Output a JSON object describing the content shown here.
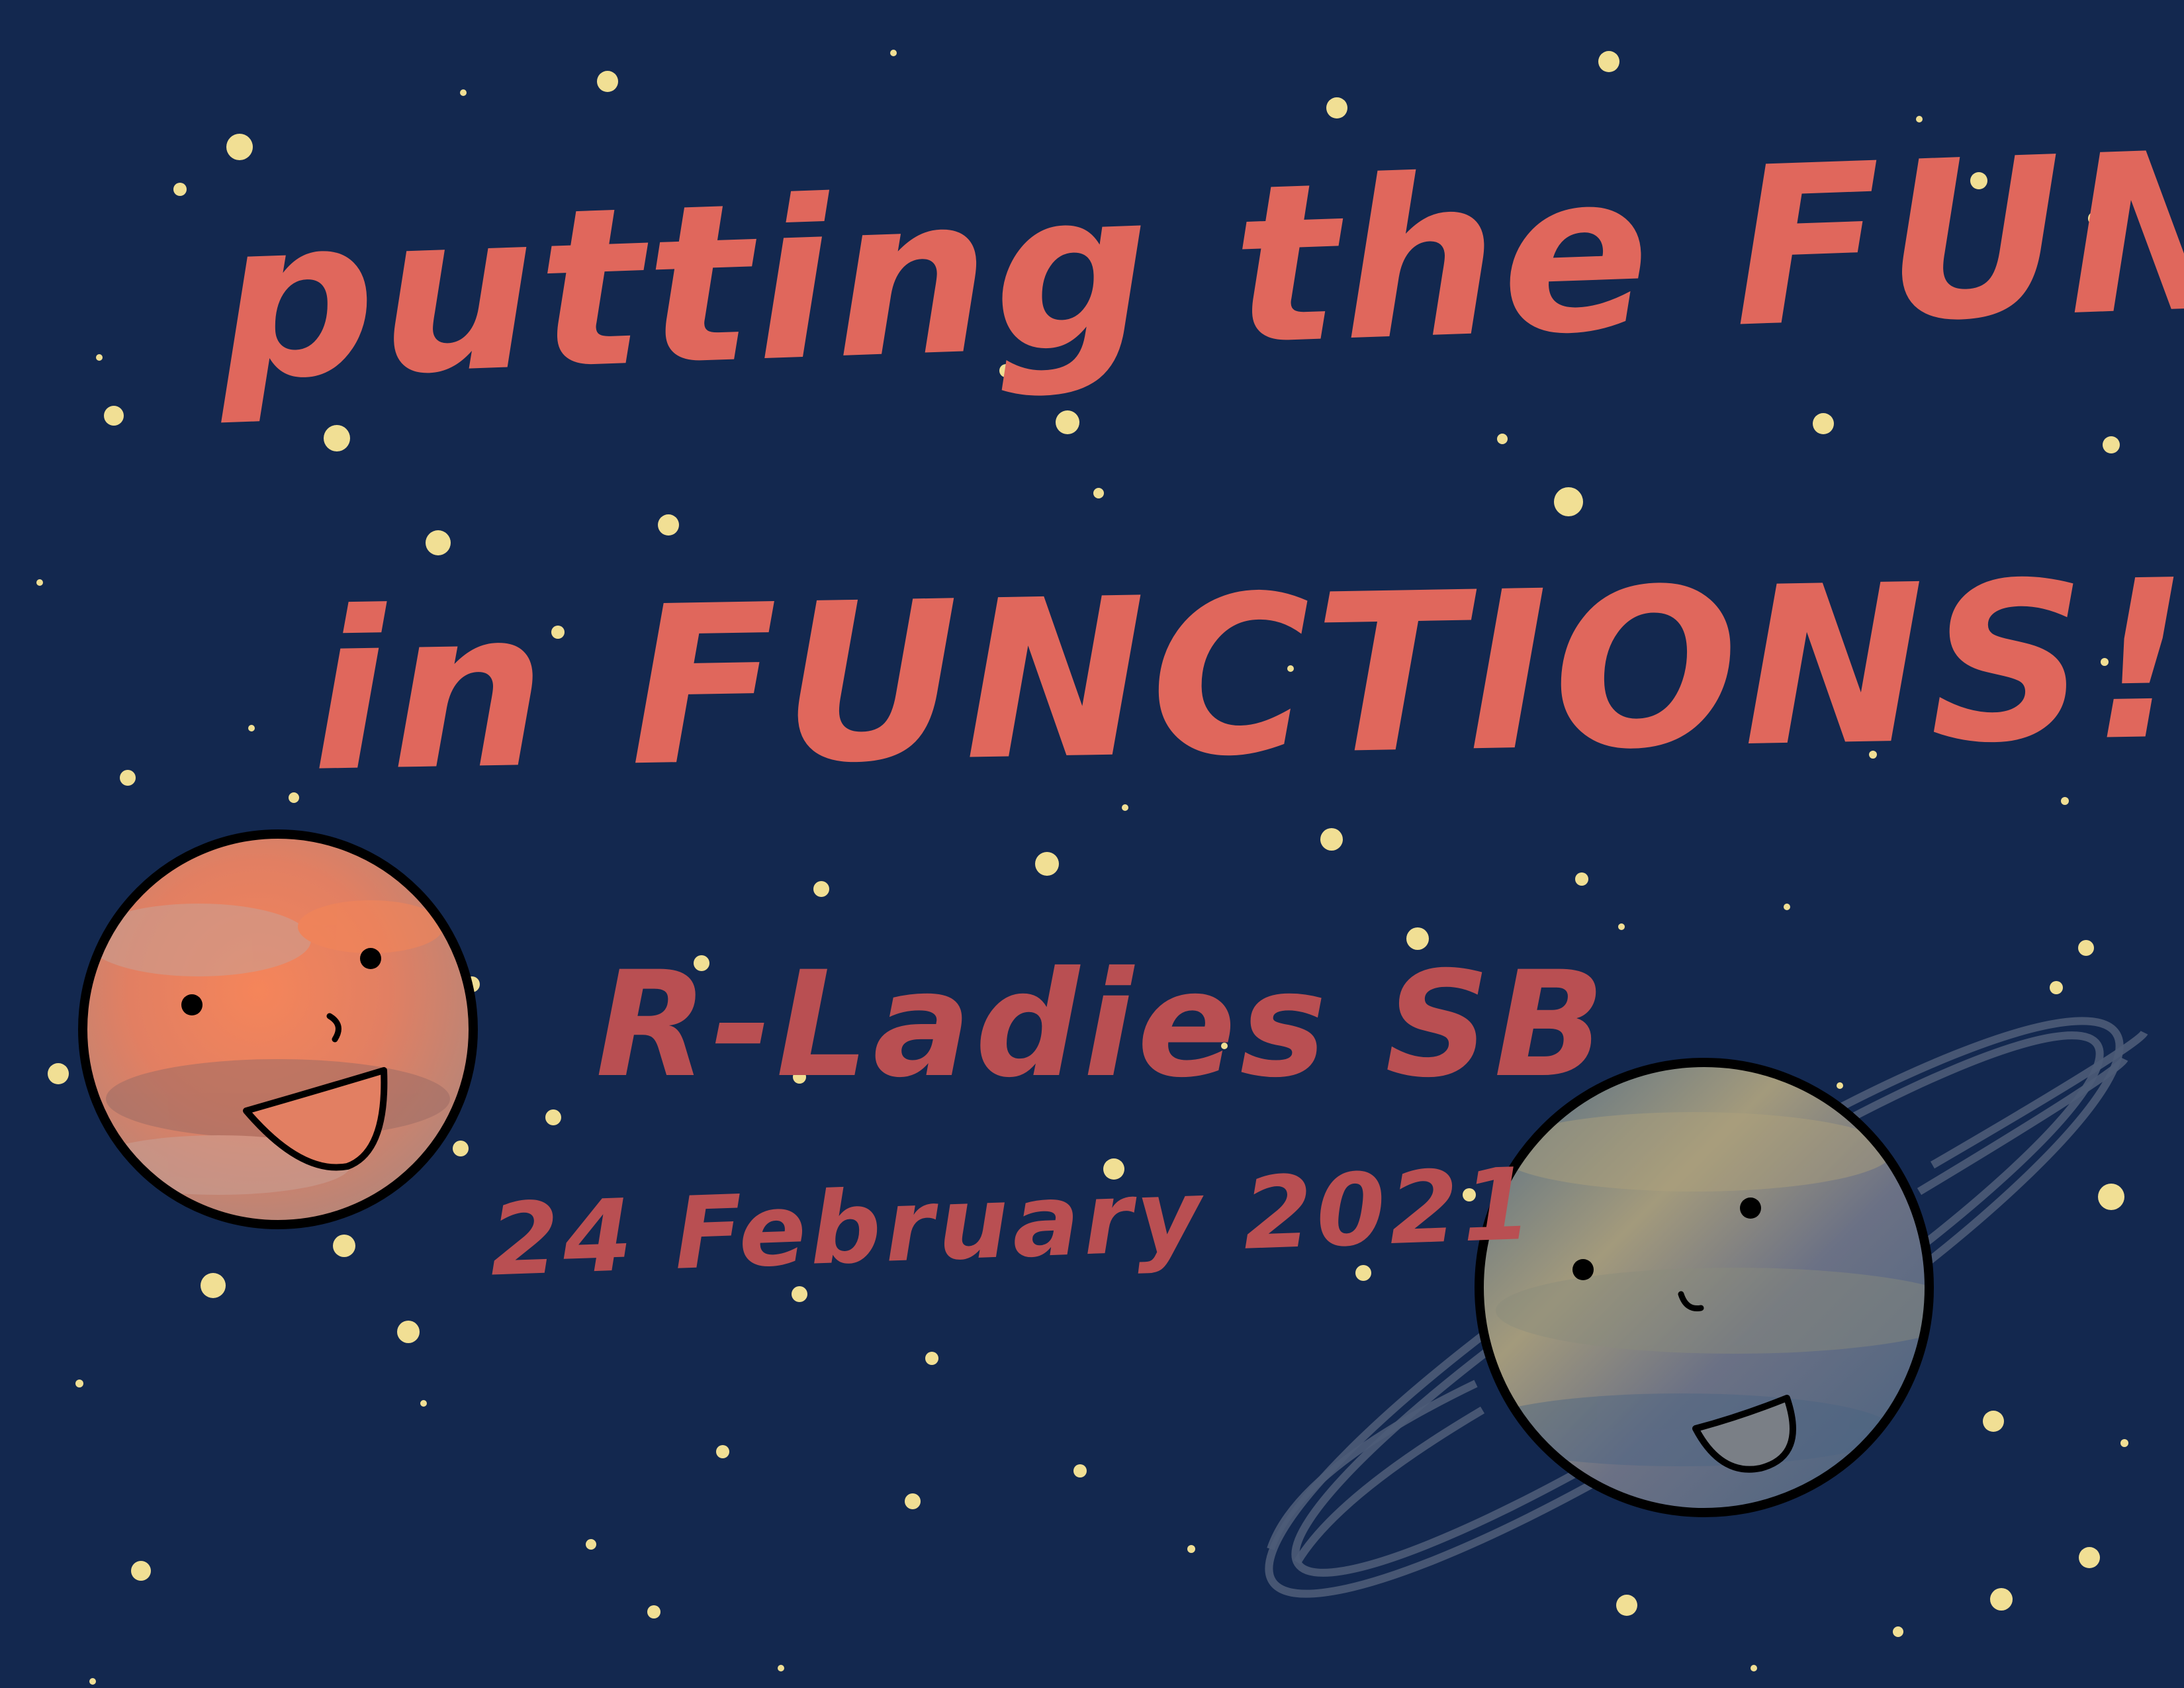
{
  "title_line_1": "putting the FUN",
  "title_line_2": "in FUNCTIONS!",
  "subtitle": "R-Ladies SB",
  "date": "24 February 2021",
  "colors": {
    "background": "#13284f",
    "title": "#e0675c",
    "subtitle": "#b94f52",
    "star": "#f1df94",
    "mars_base": "#e27f62",
    "saturn_base": "#6b7185",
    "saturn_ring": "#4d5c78"
  },
  "icons": [
    "star-icon",
    "mars-planet-icon",
    "saturn-planet-icon"
  ]
}
